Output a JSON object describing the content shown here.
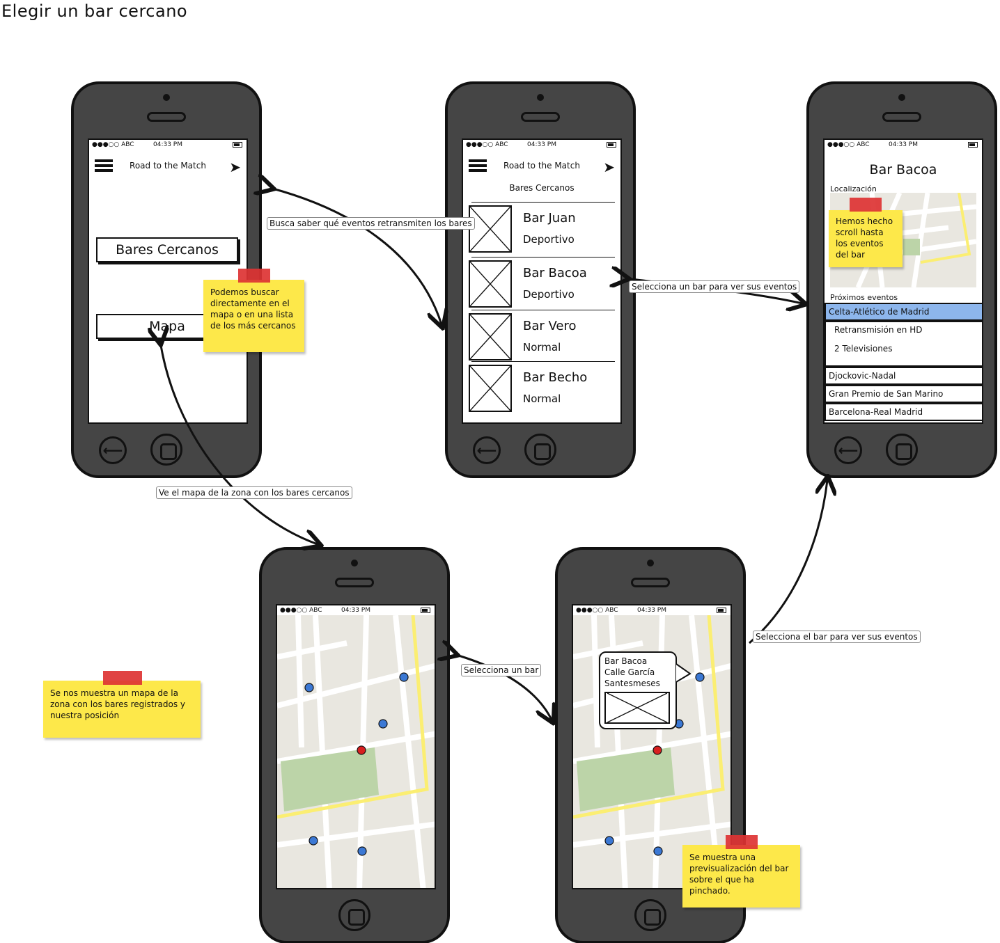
{
  "title": "Elegir un bar cercano",
  "status_bar": {
    "carrier": "●●●○○ ABC",
    "time": "04:33 PM"
  },
  "app_title": "Road to the Match",
  "screen1": {
    "btn_nearby": "Bares Cercanos",
    "btn_map": "Mapa",
    "note": "Podemos buscar directamente en el mapa o en una lista de los más cercanos"
  },
  "screen2": {
    "heading": "Bares Cercanos",
    "bars": [
      {
        "name": "Bar Juan",
        "type": "Deportivo"
      },
      {
        "name": "Bar Bacoa",
        "type": "Deportivo"
      },
      {
        "name": "Bar Vero",
        "type": "Normal"
      },
      {
        "name": "Bar Becho",
        "type": "Normal"
      }
    ]
  },
  "screen3": {
    "title": "Bar Bacoa",
    "location_label": "Localización",
    "note": "Hemos hecho scroll hasta los eventos del bar",
    "events_label": "Próximos eventos",
    "events": [
      {
        "name": "Celta-Atlético de Madrid",
        "details": [
          "Retransmisión en HD",
          "2 Televisiones"
        ]
      },
      {
        "name": "Djockovic-Nadal"
      },
      {
        "name": "Gran Premio de San Marino"
      },
      {
        "name": "Barcelona-Real Madrid"
      }
    ]
  },
  "screen5": {
    "popup_lines": [
      "Bar Bacoa",
      "Calle García",
      "Santesmeses"
    ]
  },
  "arrow_labels": {
    "to_list": "Busca saber qué eventos retransmiten los bares",
    "to_map": "Ve el mapa de la zona con los bares cercanos",
    "select_bar_events": "Selecciona un bar para ver sus eventos",
    "select_bar": "Selecciona un bar",
    "select_bar_from_map": "Selecciona el bar para ver sus eventos"
  },
  "notes": {
    "map_note": "Se nos muestra un mapa de la zona con los bares registrados y nuestra posición",
    "preview_note": "Se muestra una previsualización del bar sobre el que ha pinchado."
  },
  "colors": {
    "map_bg": "#e9e7e0",
    "park": "#bcd4a8",
    "highway": "#fbee72",
    "marker_blue": "#3b78d4",
    "marker_red": "#d81f1f",
    "note": "#fde84a",
    "tape": "#dd3333",
    "selected_event": "#8db6ec"
  }
}
